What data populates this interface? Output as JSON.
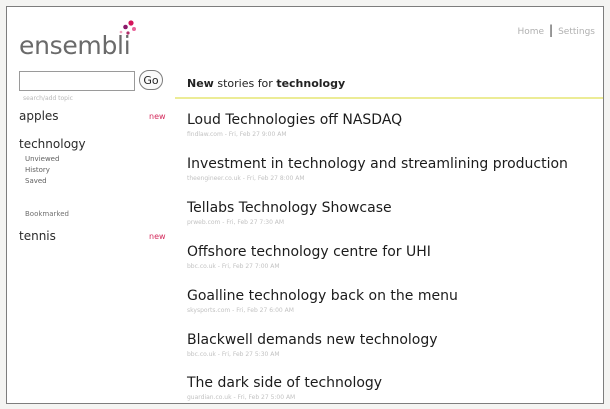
{
  "app": {
    "name": "ensembli"
  },
  "colors": {
    "brand_dots": [
      "#d4145a",
      "#8b1a6b",
      "#e8649a",
      "#b0306a",
      "#f2a0bf"
    ],
    "new_badge": "#d42a5c",
    "header_rule": "#ecec96"
  },
  "top_links": {
    "home": "Home",
    "settings": "Settings"
  },
  "search": {
    "value": "",
    "hint": "search/add topic",
    "go_label": "Go"
  },
  "sidebar": {
    "topics": [
      {
        "label": "apples",
        "badge": "new"
      },
      {
        "label": "technology",
        "badge": "",
        "subitems": [
          "Unviewed",
          "History",
          "Saved"
        ]
      },
      {
        "label": "tennis",
        "badge": "new"
      }
    ],
    "bookmarked_label": "Bookmarked"
  },
  "main": {
    "heading_prefix": "New",
    "heading_middle": " stories for ",
    "heading_topic": "technology",
    "stories": [
      {
        "title": "Loud Technologies off NASDAQ",
        "meta": "findlaw.com - Fri, Feb 27 9:00 AM"
      },
      {
        "title": "Investment in technology and streamlining production",
        "meta": "theengineer.co.uk - Fri, Feb 27 8:00 AM"
      },
      {
        "title": "Tellabs Technology Showcase",
        "meta": "prweb.com - Fri, Feb 27 7:30 AM"
      },
      {
        "title": "Offshore technology centre for UHI",
        "meta": "bbc.co.uk - Fri, Feb 27 7:00 AM"
      },
      {
        "title": "Goalline technology back on the menu",
        "meta": "skysports.com - Fri, Feb 27 6:00 AM"
      },
      {
        "title": "Blackwell demands new technology",
        "meta": "bbc.co.uk - Fri, Feb 27 5:30 AM"
      },
      {
        "title": "The dark side of technology",
        "meta": "guardian.co.uk - Fri, Feb 27 5:00 AM"
      }
    ]
  }
}
